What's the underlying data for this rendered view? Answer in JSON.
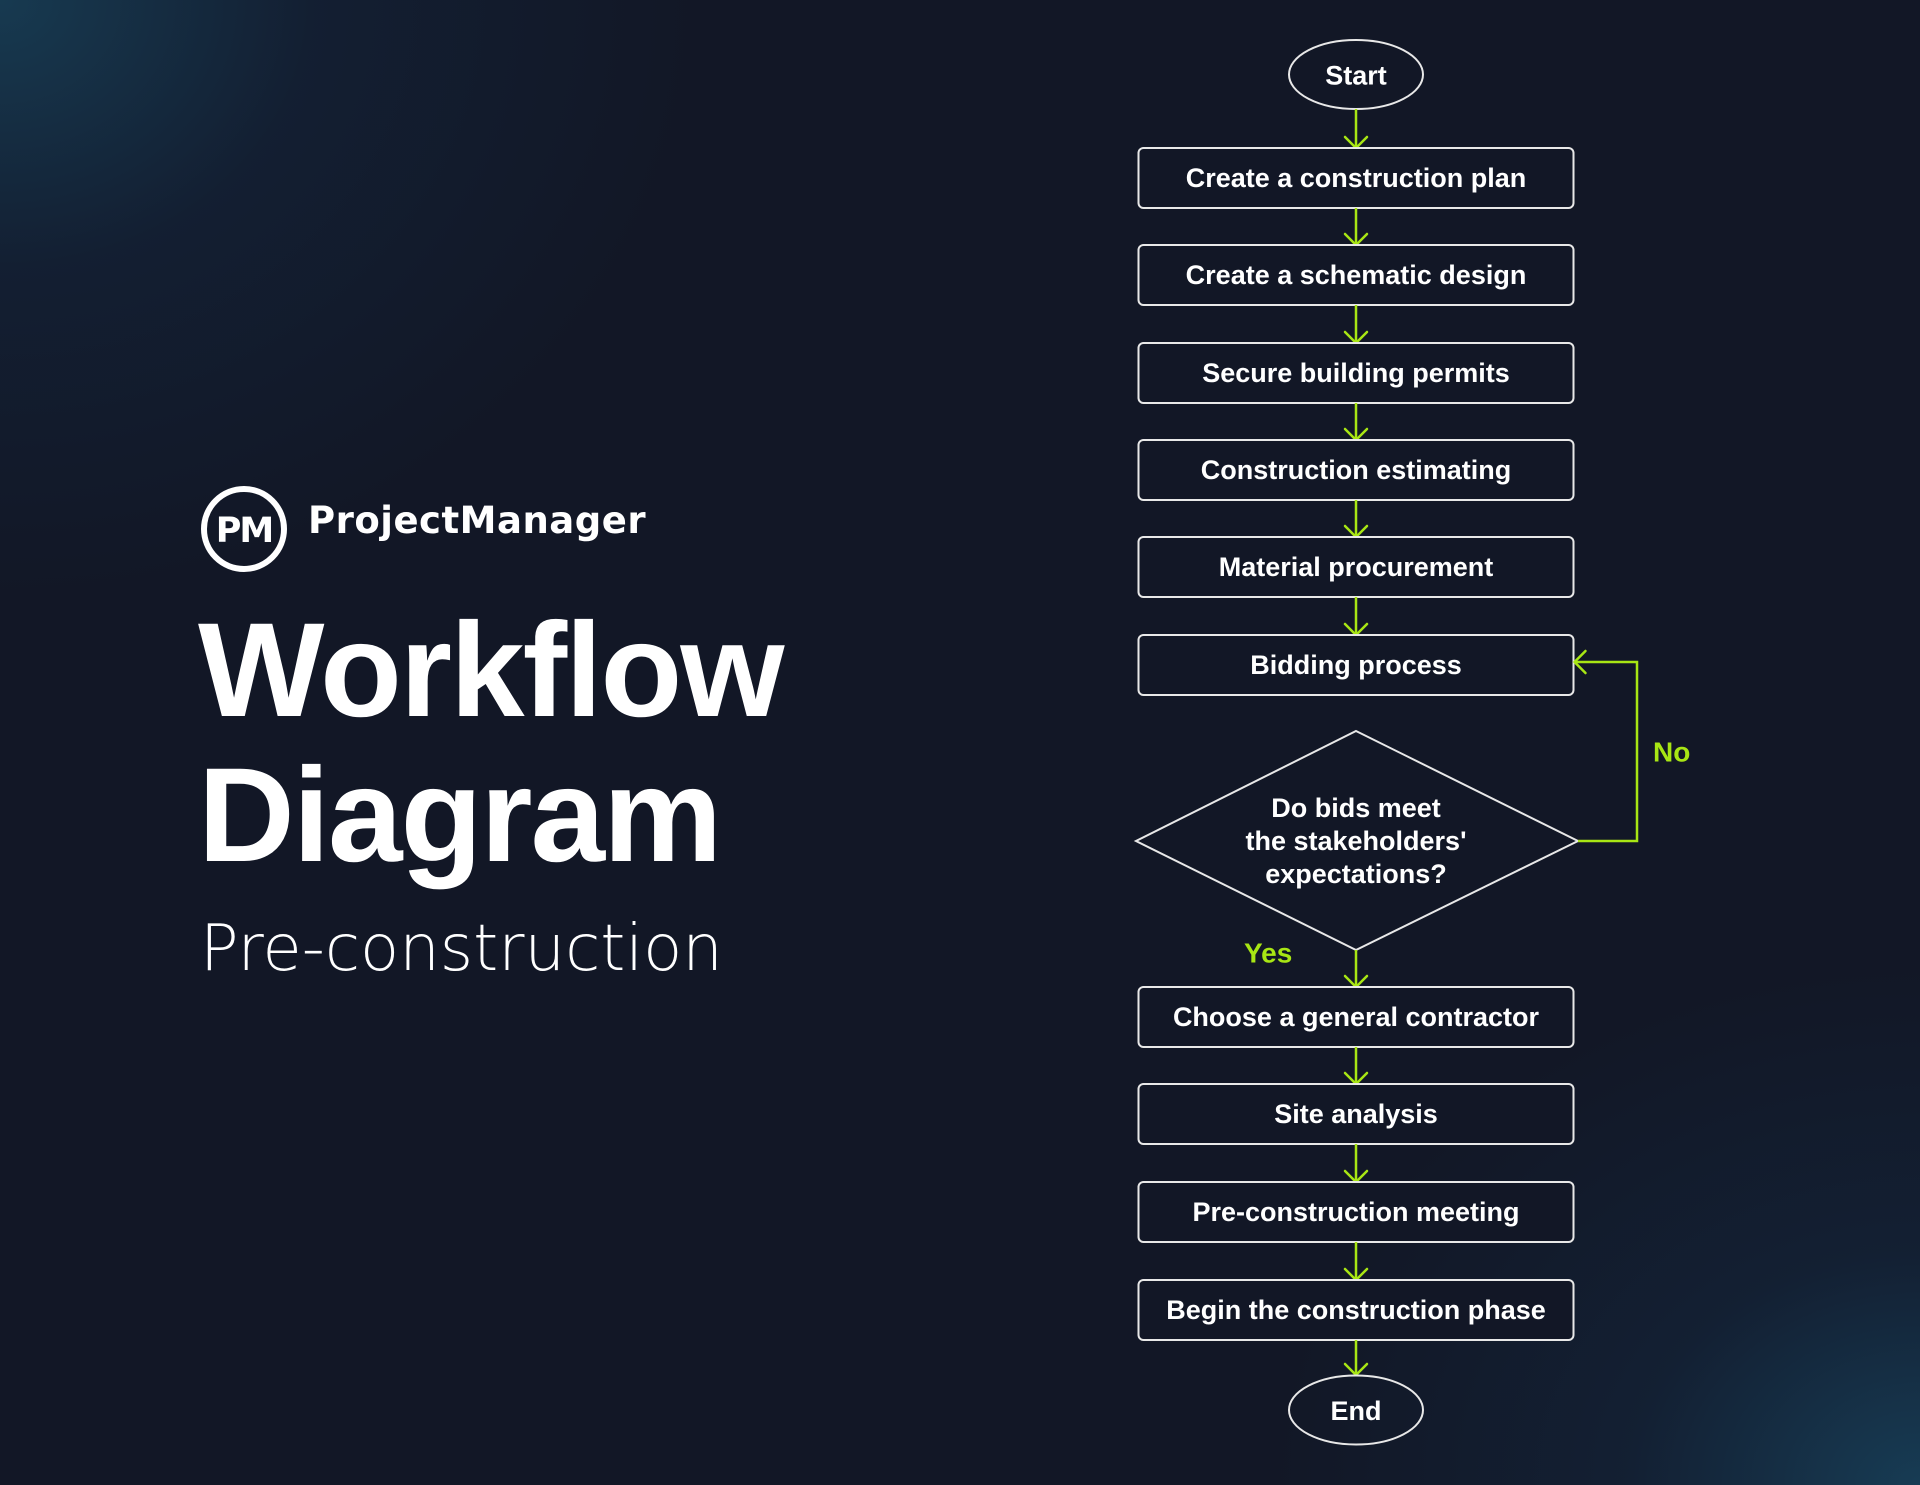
{
  "brand": {
    "logo_monogram": "PM",
    "name": "ProjectManager"
  },
  "title": {
    "line1": "Workflow",
    "line2": "Diagram"
  },
  "subtitle": "Pre-construction",
  "colors": {
    "background": "#121726",
    "glow": "#18405a",
    "node_stroke": "#e8e8e8",
    "connector": "#a8e614",
    "text": "#ffffff"
  },
  "flowchart": {
    "start": {
      "label": "Start",
      "shape": "terminal"
    },
    "steps": [
      {
        "id": "s1",
        "label": "Create a construction plan",
        "shape": "process"
      },
      {
        "id": "s2",
        "label": "Create a schematic design",
        "shape": "process"
      },
      {
        "id": "s3",
        "label": "Secure building permits",
        "shape": "process"
      },
      {
        "id": "s4",
        "label": "Construction estimating",
        "shape": "process"
      },
      {
        "id": "s5",
        "label": "Material procurement",
        "shape": "process"
      },
      {
        "id": "s6",
        "label": "Bidding process",
        "shape": "process"
      }
    ],
    "decision": {
      "lines": [
        "Do bids meet",
        "the stakeholders'",
        "expectations?"
      ],
      "yes_label": "Yes",
      "no_label": "No",
      "no_target": "s6"
    },
    "after_steps": [
      {
        "id": "s7",
        "label": "Choose a general contractor",
        "shape": "process"
      },
      {
        "id": "s8",
        "label": "Site analysis",
        "shape": "process"
      },
      {
        "id": "s9",
        "label": "Pre-construction meeting",
        "shape": "process"
      },
      {
        "id": "s10",
        "label": "Begin the construction phase",
        "shape": "process"
      }
    ],
    "end": {
      "label": "End",
      "shape": "terminal"
    }
  }
}
